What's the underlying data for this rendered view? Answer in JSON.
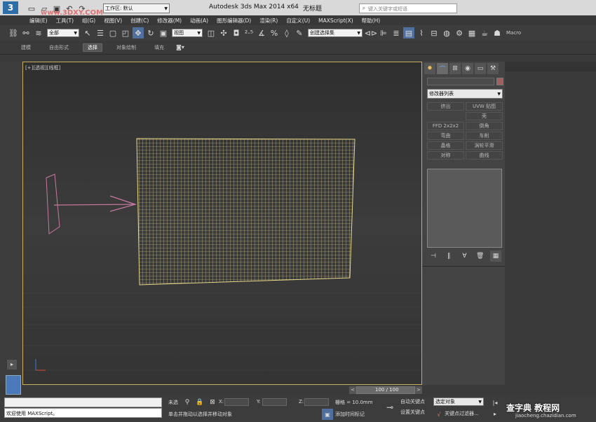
{
  "title_bar": {
    "workspace_label": "工作区: 默认",
    "app_title": "Autodesk 3ds Max  2014 x64",
    "doc_title": "无标题",
    "search_placeholder": "键入关键字或短语",
    "watermark_top": "www.3DXY.COM"
  },
  "menu": [
    "编辑(E)",
    "工具(T)",
    "组(G)",
    "视图(V)",
    "创建(C)",
    "修改器(M)",
    "动画(A)",
    "图形编辑器(D)",
    "渲染(R)",
    "自定义(U)",
    "MAXScript(X)",
    "帮助(H)"
  ],
  "toolbar": {
    "filter_select": "全部",
    "coord_select": "视图",
    "selection_set": "创建选择集",
    "macro_label": "Macro"
  },
  "ribbon_tabs": [
    "建模",
    "自由形式",
    "选择",
    "对象绘制",
    "填充"
  ],
  "viewport": {
    "label": "[+][透视][线框]"
  },
  "command_panel": {
    "modifier_list": "修改器列表",
    "buttons": [
      "挤出",
      "UVW 贴图",
      "壳",
      "FFD 2x2x2",
      "倒角",
      "弯曲",
      "车削",
      "晶格",
      "涡轮平滑",
      "对称",
      "曲线"
    ]
  },
  "timeline": {
    "counter": "100 / 100"
  },
  "status": {
    "maxscript_prompt": "欢迎使用 MAXScript。",
    "selection": "未选",
    "hint": "单击并拖动以选择并移动对象",
    "x_label": "X:",
    "y_label": "Y:",
    "z_label": "Z:",
    "grid": "栅格 = 10.0mm",
    "add_time_tag": "添加时间标记",
    "auto_key": "自动关键点",
    "set_key": "设置关键点",
    "selected_obj": "选定对象",
    "key_filter": "关键点过滤器..."
  },
  "watermarks": {
    "bottom_site": "查字典 教程网",
    "bottom_url": "jiaocheng.chazidian.com"
  },
  "colors": {
    "grid_mesh": "#e6d88a",
    "helper": "#c87aa0",
    "viewport_bg": "#353535",
    "panel_bg": "#444444"
  }
}
